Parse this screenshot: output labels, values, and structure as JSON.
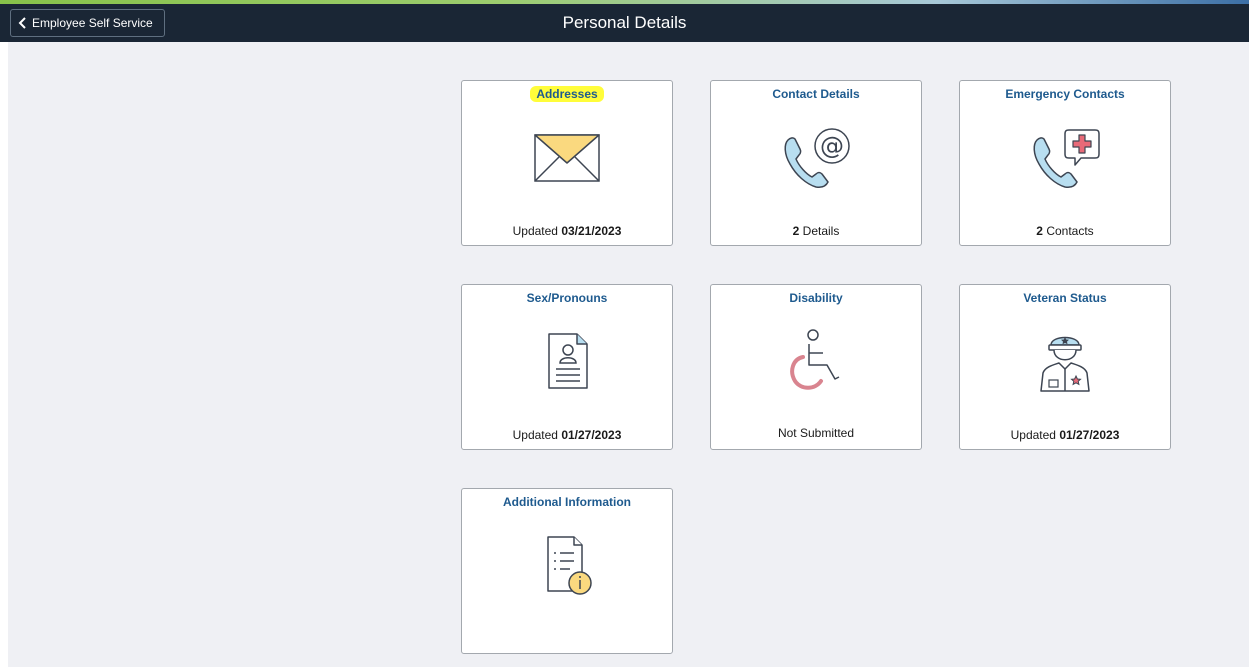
{
  "header": {
    "back_label": "Employee Self Service",
    "title": "Personal Details"
  },
  "tiles": [
    {
      "title": "Addresses",
      "highlighted": true,
      "icon": "envelope-icon",
      "footer_pre": "Updated ",
      "footer_value": "03/21/2023",
      "footer_post": ""
    },
    {
      "title": "Contact Details",
      "icon": "phone-at-icon",
      "footer_pre": "",
      "footer_value": "2",
      "footer_post": " Details"
    },
    {
      "title": "Emergency Contacts",
      "icon": "phone-medical-icon",
      "footer_pre": "",
      "footer_value": "2",
      "footer_post": " Contacts"
    },
    {
      "title": "Sex/Pronouns",
      "icon": "id-document-icon",
      "footer_pre": "Updated ",
      "footer_value": "01/27/2023",
      "footer_post": ""
    },
    {
      "title": "Disability",
      "icon": "wheelchair-icon",
      "footer_pre": "Not Submitted",
      "footer_value": "",
      "footer_post": ""
    },
    {
      "title": "Veteran Status",
      "icon": "veteran-officer-icon",
      "footer_pre": "Updated ",
      "footer_value": "01/27/2023",
      "footer_post": ""
    },
    {
      "title": "Additional Information",
      "icon": "info-document-icon",
      "footer_pre": "",
      "footer_value": "",
      "footer_post": ""
    }
  ],
  "colors": {
    "header_bg": "#1a2635",
    "content_bg": "#eff0f4",
    "tile_title": "#1e5a8e",
    "highlight": "#fffd3a",
    "icon_blue": "#b8def0",
    "icon_yellow": "#fad97f",
    "icon_red": "#d9848f",
    "icon_stroke": "#3d4552"
  }
}
